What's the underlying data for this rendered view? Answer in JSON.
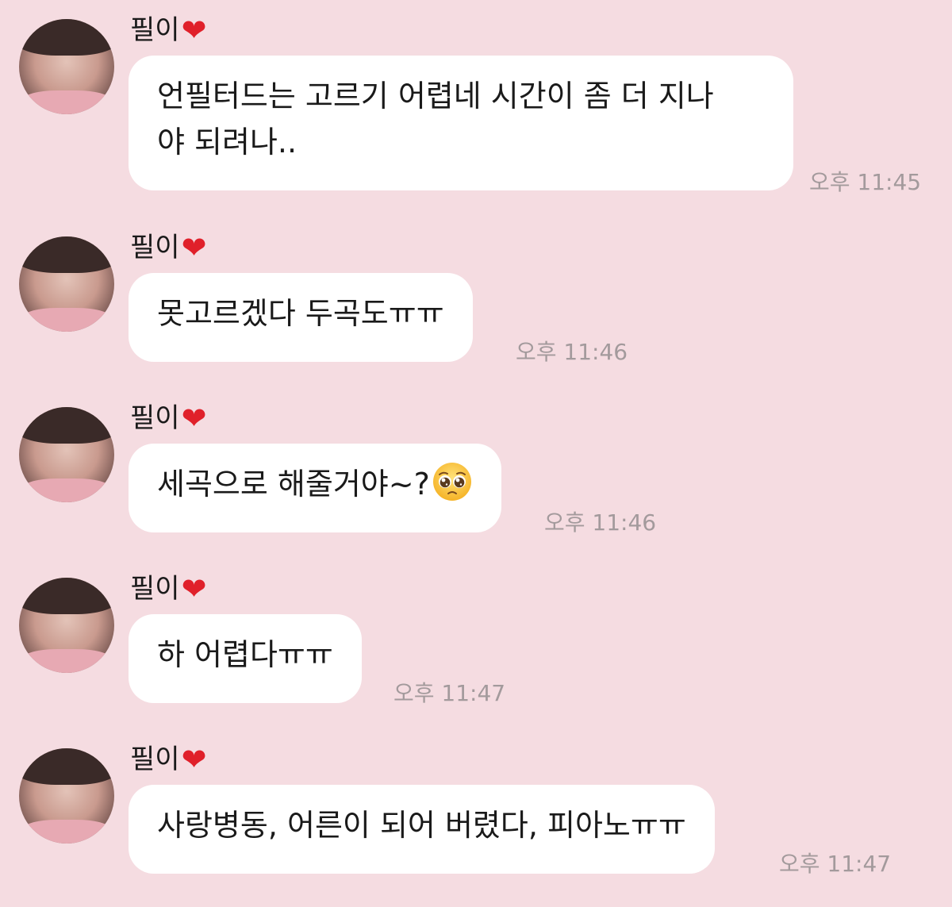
{
  "sender": {
    "name": "필이",
    "name_icon": "heart-icon",
    "name_icon_glyph": "❤"
  },
  "messages": [
    {
      "lines": [
        "언필터드는 고르기 어렵네 시간이 좀 더 지나",
        "야 되려나.."
      ],
      "time": "오후 11:45"
    },
    {
      "lines": [
        "못고르겠다 두곡도ㅠㅠ"
      ],
      "time": "오후 11:46"
    },
    {
      "lines": [
        "세곡으로 해줄거야~?"
      ],
      "emoji": "pleading-face-icon",
      "time": "오후 11:46"
    },
    {
      "lines": [
        "하 어렵다ㅠㅠ"
      ],
      "time": "오후 11:47"
    },
    {
      "lines": [
        "사랑병동, 어른이 되어 버렸다, 피아노ㅠㅠ"
      ],
      "time": "오후 11:47"
    }
  ],
  "colors": {
    "background": "#f5dce1",
    "bubble": "#ffffff",
    "heart": "#e0202a",
    "timestamp": "#a39a9c"
  }
}
